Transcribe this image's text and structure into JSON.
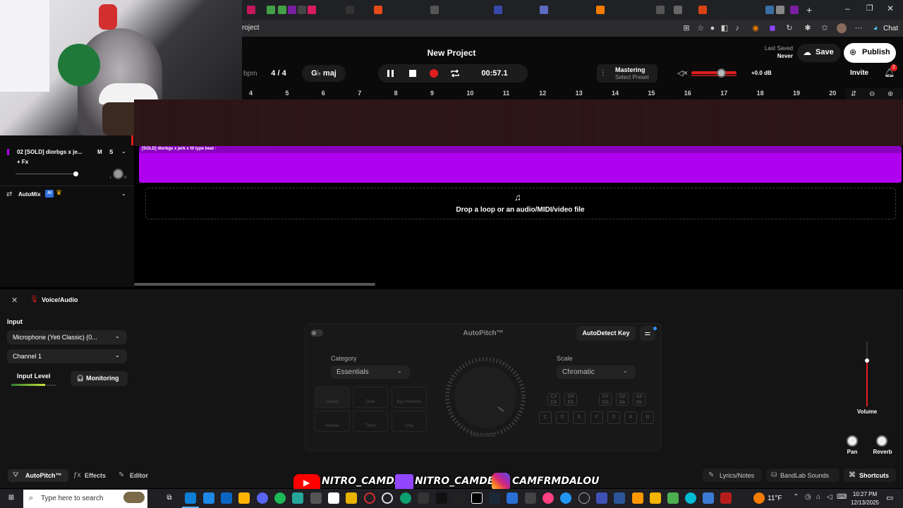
{
  "browser": {
    "address_partial": "roject",
    "chat_label": "Chat"
  },
  "header": {
    "project_title": "New Project",
    "bpm_label": "bpm",
    "time_signature": "4 / 4",
    "key": "G♭ maj",
    "time": "00:57.1",
    "mastering_label": "Mastering",
    "mastering_preset": "Select Preset",
    "last_saved_label": "Last Saved",
    "last_saved_value": "Never",
    "save_label": "Save",
    "publish_label": "Publish",
    "invite_label": "Invite",
    "volume_db": "+0.0 dB",
    "notif_count": "2"
  },
  "ruler": [
    "4",
    "5",
    "6",
    "7",
    "8",
    "9",
    "10",
    "11",
    "12",
    "13",
    "14",
    "15",
    "16",
    "17",
    "18",
    "19",
    "20"
  ],
  "track": {
    "name": "02  [SOLD] diorbgs x je...",
    "mute": "M",
    "solo": "S",
    "fx": "+ Fx",
    "clip_label": "[SOLD] diorbgs x jerk x ttl type beat -",
    "pan_l": "L",
    "pan_r": "R"
  },
  "automix": {
    "label": "AutoMix",
    "ai_badge": "AI"
  },
  "drop_zone": "Drop a loop or an audio/MIDI/video file",
  "panel": {
    "title": "Voice/Audio",
    "input_label": "Input",
    "mic": "Microphone (Yeti Classic) (0...",
    "channel": "Channel 1",
    "input_level": "Input Level",
    "monitoring": "Monitoring"
  },
  "autopitch": {
    "title": "AutoPitch™",
    "detect_key": "AutoDetect Key",
    "category_label": "Category",
    "category_value": "Essentials",
    "scale_label": "Scale",
    "scale_value": "Chromatic",
    "knob_label": "Heaviest",
    "tiles": [
      "Classic",
      "Duet",
      "Big Harmony",
      "Natural",
      "Third",
      "Chip"
    ],
    "keys_top": [
      "C#\nDb",
      "D#\nEb",
      "F#\nGb",
      "G#\nAb",
      "A#\nBb"
    ],
    "keys_bottom": [
      "C",
      "D",
      "E",
      "F",
      "G",
      "A",
      "B"
    ]
  },
  "right_controls": {
    "volume": "Volume",
    "pan": "Pan",
    "reverb": "Reverb"
  },
  "status": {
    "autopitch_tab": "AutoPitch™",
    "effects_tab": "Effects",
    "editor_tab": "Editor",
    "lyrics": "Lyrics/Notes",
    "sounds": "BandLab Sounds",
    "shortcuts": "Shortcuts"
  },
  "overlay": {
    "youtube": "NITRO_CAMDEN",
    "twitch": "NITRO_CAMDEN",
    "instagram": "CAMFRMDALOU"
  },
  "taskbar": {
    "search_placeholder": "Type here to search",
    "temperature": "11°F",
    "time": "10:27 PM",
    "date": "12/13/2025"
  },
  "colors": {
    "clip": "#b000f0",
    "record": "#e01e1e",
    "volume_slider": "#e01e1e"
  }
}
